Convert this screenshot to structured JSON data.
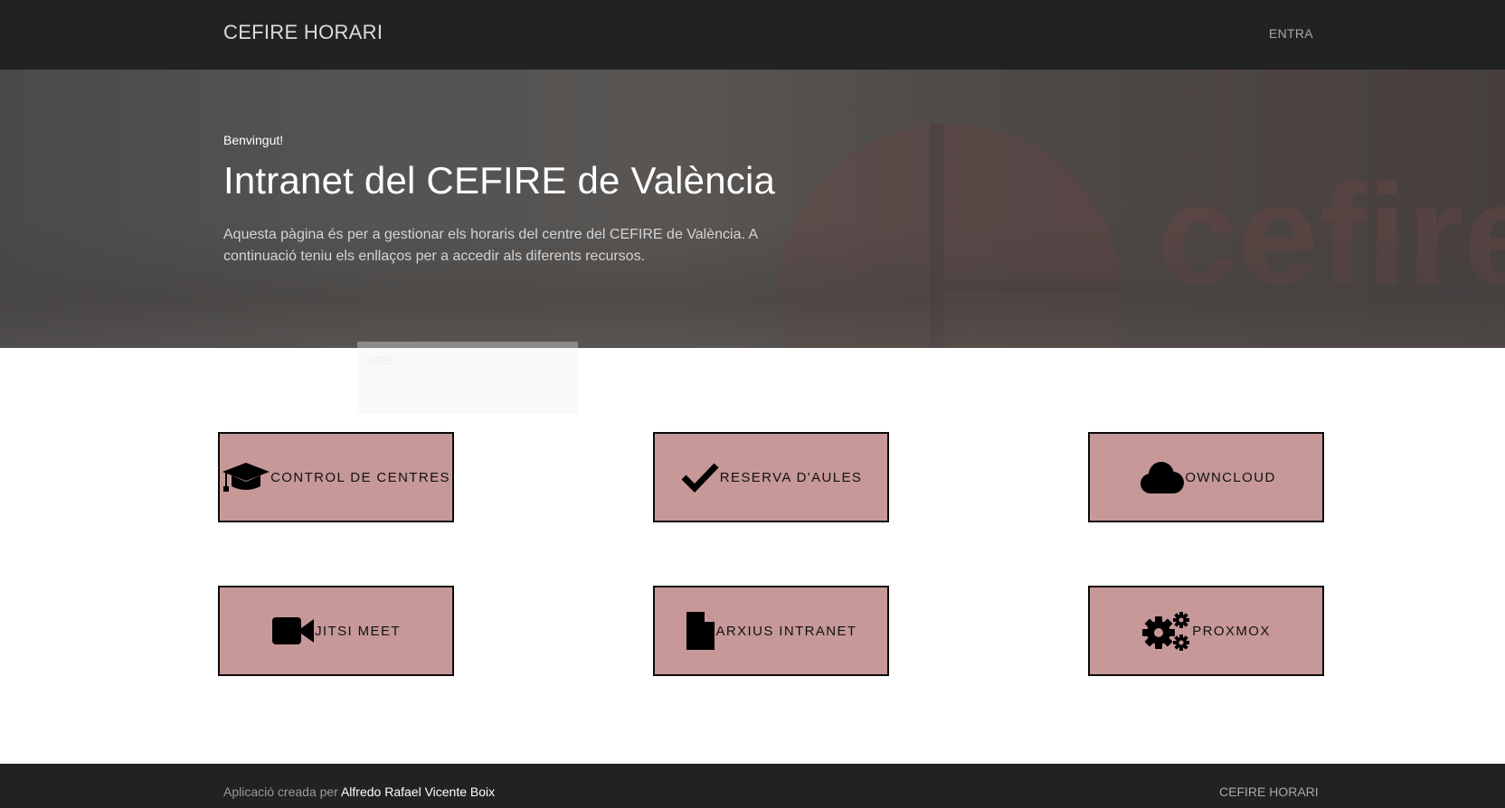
{
  "navbar": {
    "brand": "CEFIRE HORARI",
    "login_link": "ENTRA"
  },
  "hero": {
    "greeting": "Benvingut!",
    "title": "Intranet del CEFIRE de València",
    "description": "Aquesta pàgina és per a gestionar els horaris del centre del CEFIRE de València. A continuació teniu els enllaços per a accedir als diferents recursos.",
    "background_logo_text": "cefire",
    "ghost_text": "este"
  },
  "cards": [
    {
      "label": "CONTROL DE CENTRES",
      "icon": "graduation-cap-icon"
    },
    {
      "label": "RESERVA D'AULES",
      "icon": "checkmark-icon"
    },
    {
      "label": "OWNCLOUD",
      "icon": "cloud-icon"
    },
    {
      "label": "JITSI MEET",
      "icon": "video-camera-icon"
    },
    {
      "label": "ARXIUS INTRANET",
      "icon": "file-icon"
    },
    {
      "label": "PROXMOX",
      "icon": "gears-icon"
    }
  ],
  "footer": {
    "prefix": "Aplicació creada per ",
    "author": "Alfredo Rafael Vicente Boix",
    "right_link": "CEFIRE HORARI"
  },
  "colors": {
    "navbar_bg": "#222222",
    "card_bg": "#c79898",
    "card_border": "#0a0a0a",
    "footer_bg": "#222222"
  }
}
